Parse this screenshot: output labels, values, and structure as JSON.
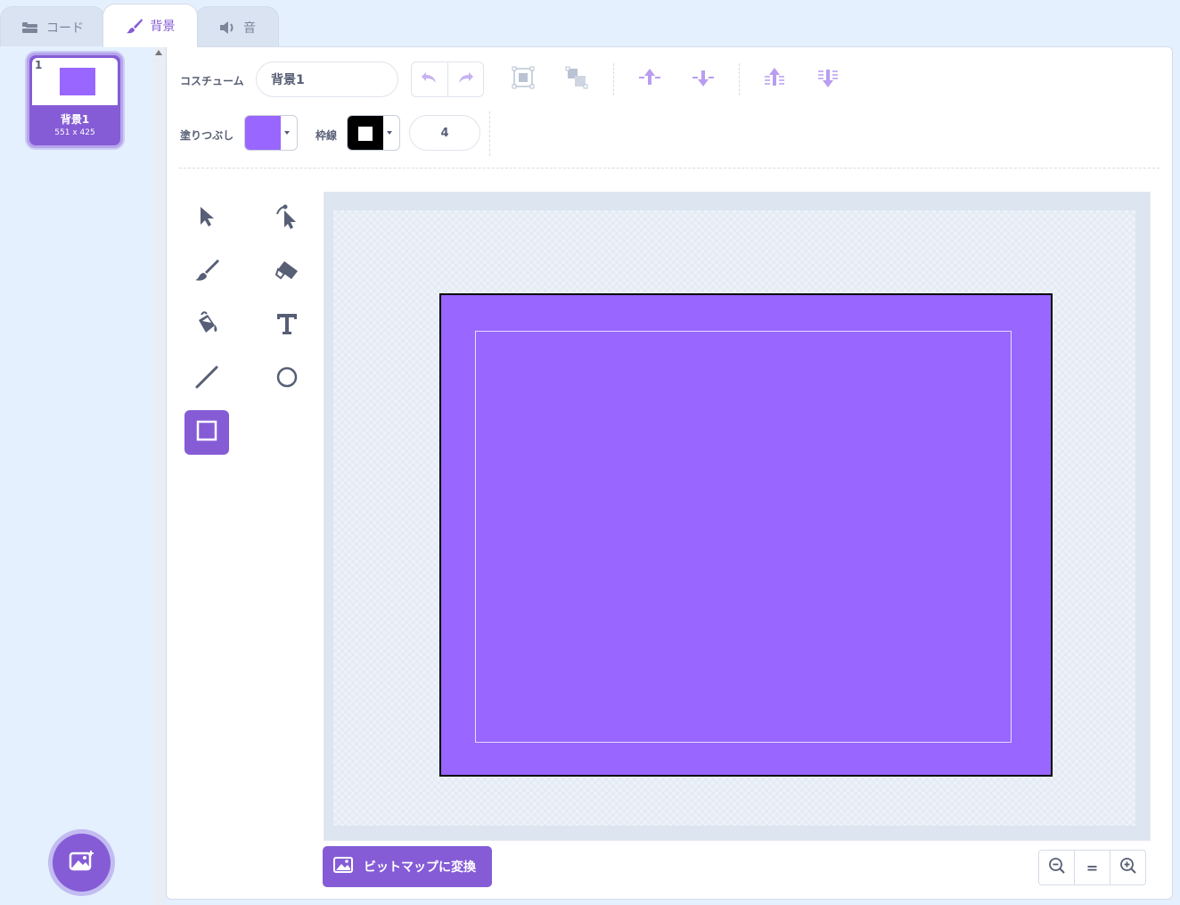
{
  "tabs": [
    {
      "label": "コード",
      "icon": "code-icon"
    },
    {
      "label": "背景",
      "icon": "brush-icon"
    },
    {
      "label": "音",
      "icon": "speaker-icon"
    }
  ],
  "costume_list": {
    "items": [
      {
        "index": "1",
        "name": "背景1",
        "size": "551 x 425"
      }
    ]
  },
  "toolbar": {
    "costume_label": "コスチューム",
    "costume_name": "背景1",
    "fill_label": "塗りつぶし",
    "outline_label": "枠線",
    "outline_width": "4"
  },
  "colors": {
    "fill": "#9966ff",
    "outline": "#000000",
    "accent": "#855cd6"
  },
  "tools": [
    "select-tool",
    "reshape-tool",
    "brush-tool",
    "eraser-tool",
    "fill-tool",
    "text-tool",
    "line-tool",
    "circle-tool",
    "rectangle-tool"
  ],
  "active_tool": "rectangle-tool",
  "bitmap_button": {
    "label": "ビットマップに変換"
  },
  "zoom": {
    "reset_label": "="
  }
}
